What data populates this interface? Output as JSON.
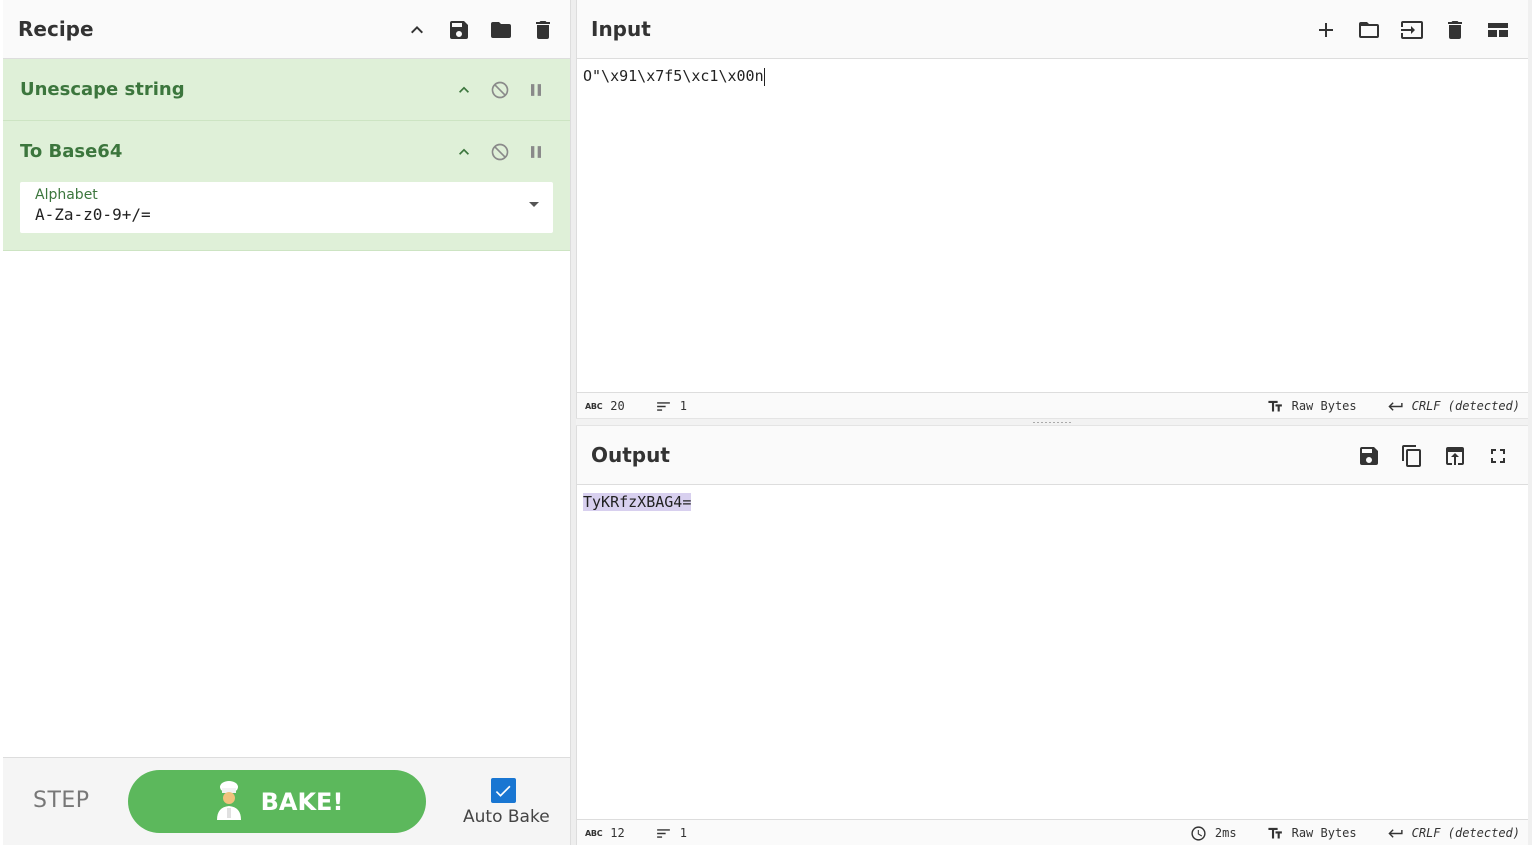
{
  "recipe": {
    "title": "Recipe",
    "operations": [
      {
        "name": "Unescape string"
      },
      {
        "name": "To Base64",
        "arg": {
          "label": "Alphabet",
          "value": "A-Za-z0-9+/="
        }
      }
    ]
  },
  "controls": {
    "step_label": "STEP",
    "bake_label": "BAKE!",
    "auto_bake_label": "Auto Bake",
    "auto_bake_checked": true
  },
  "input": {
    "title": "Input",
    "text": "O\"\\x91\\x7f5\\xc1\\x00n",
    "status": {
      "chars": "20",
      "lines": "1",
      "encoding": "Raw Bytes",
      "eol": "CRLF (detected)"
    }
  },
  "output": {
    "title": "Output",
    "text": "TyKRfzXBAG4=",
    "status": {
      "chars": "12",
      "lines": "1",
      "time": "2ms",
      "encoding": "Raw Bytes",
      "eol": "CRLF (detected)"
    }
  },
  "colors": {
    "accent": "#5cb85c",
    "op_bg": "#dff0d8",
    "op_text": "#3c763d",
    "checkbox": "#1976d2"
  }
}
